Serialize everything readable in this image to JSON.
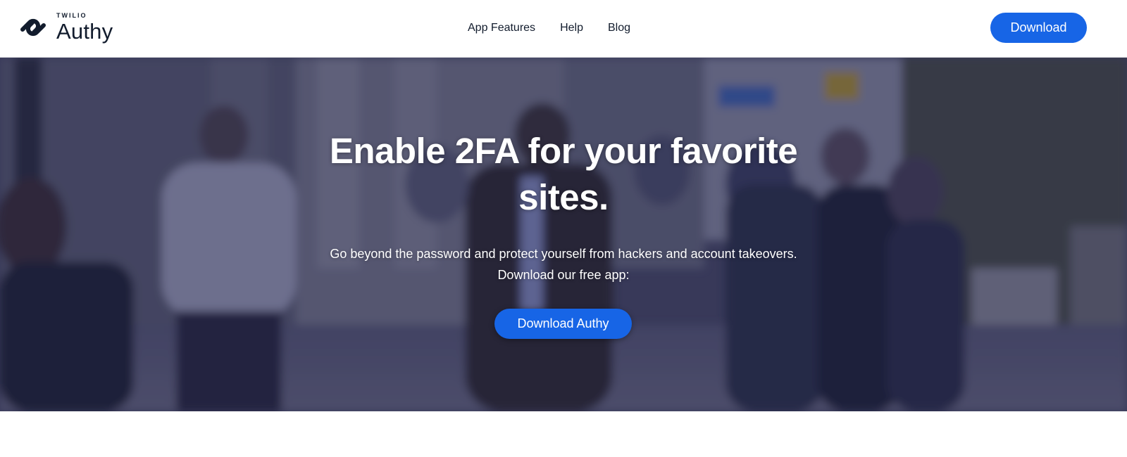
{
  "header": {
    "logo": {
      "icon": "authy-logo-icon",
      "sub": "TWILIO",
      "name": "Authy"
    },
    "nav": [
      {
        "label": "App Features"
      },
      {
        "label": "Help"
      },
      {
        "label": "Blog"
      }
    ],
    "download_label": "Download"
  },
  "hero": {
    "title": "Enable 2FA for your favorite sites.",
    "text_line1": "Go beyond the password and protect yourself from hackers and account takeovers.",
    "text_line2": "Download our free app:",
    "cta_label": "Download Authy",
    "background_image": "blurred-city-street-pedestrians"
  },
  "colors": {
    "brand_blue": "#1765e6",
    "text_dark": "#121c2d",
    "header_border": "#d9d9de"
  }
}
